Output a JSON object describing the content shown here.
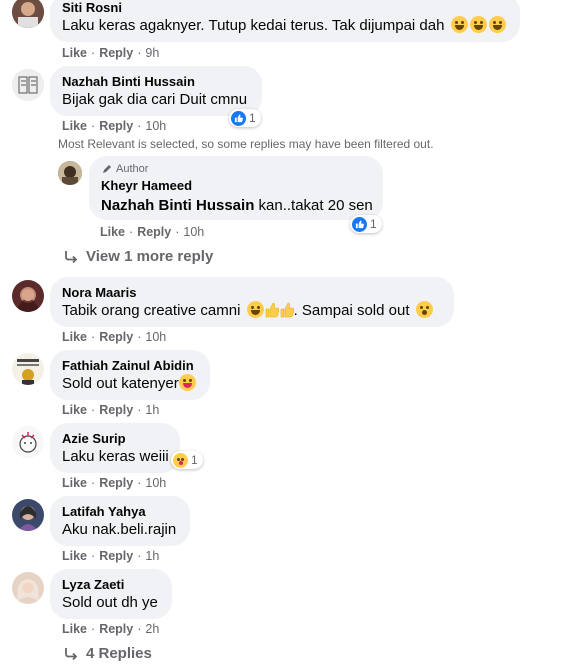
{
  "comments": [
    {
      "author": "Siti Rosni",
      "text": "Laku keras agaknyer. Tutup kedai terus. Tak dijumpai dah",
      "emoji": "laugh x3",
      "like": "Like",
      "reply": "Reply",
      "time": "9h"
    },
    {
      "author": "Nazhah Binti Hussain",
      "text": "Bijak gak dia cari Duit cmnu",
      "like": "Like",
      "reply": "Reply",
      "time": "10h",
      "reaction_count": "1"
    },
    {
      "author": "Nora Maaris",
      "text": "Tabik orang creative camni",
      "text2": ". Sampai sold out",
      "like": "Like",
      "reply": "Reply",
      "time": "10h"
    },
    {
      "author": "Fathiah Zainul Abidin",
      "text": "Sold out katenyer",
      "like": "Like",
      "reply": "Reply",
      "time": "1h"
    },
    {
      "author": "Azie Surip",
      "text": "Laku keras weiii",
      "like": "Like",
      "reply": "Reply",
      "time": "10h",
      "reaction_count": "1"
    },
    {
      "author": "Latifah Yahya",
      "text": "Aku nak.beli.rajin",
      "like": "Like",
      "reply": "Reply",
      "time": "1h"
    },
    {
      "author": "Lyza Zaeti",
      "text": "Sold out dh ye",
      "like": "Like",
      "reply": "Reply",
      "time": "2h"
    }
  ],
  "filter_note": "Most Relevant is selected, so some replies may have been filtered out.",
  "reply": {
    "badge": "Author",
    "author": "Kheyr Hameed",
    "mention": "Nazhah Binti Hussain",
    "text": " kan..takat 20 sen",
    "like": "Like",
    "reply": "Reply",
    "time": "10h",
    "reaction_count": "1"
  },
  "view_more_reply": "View 1 more reply",
  "view_replies": "4 Replies",
  "colors": {
    "bubble": "#f0f2f5",
    "meta": "#65676b",
    "like_blue": "#1877f2"
  }
}
